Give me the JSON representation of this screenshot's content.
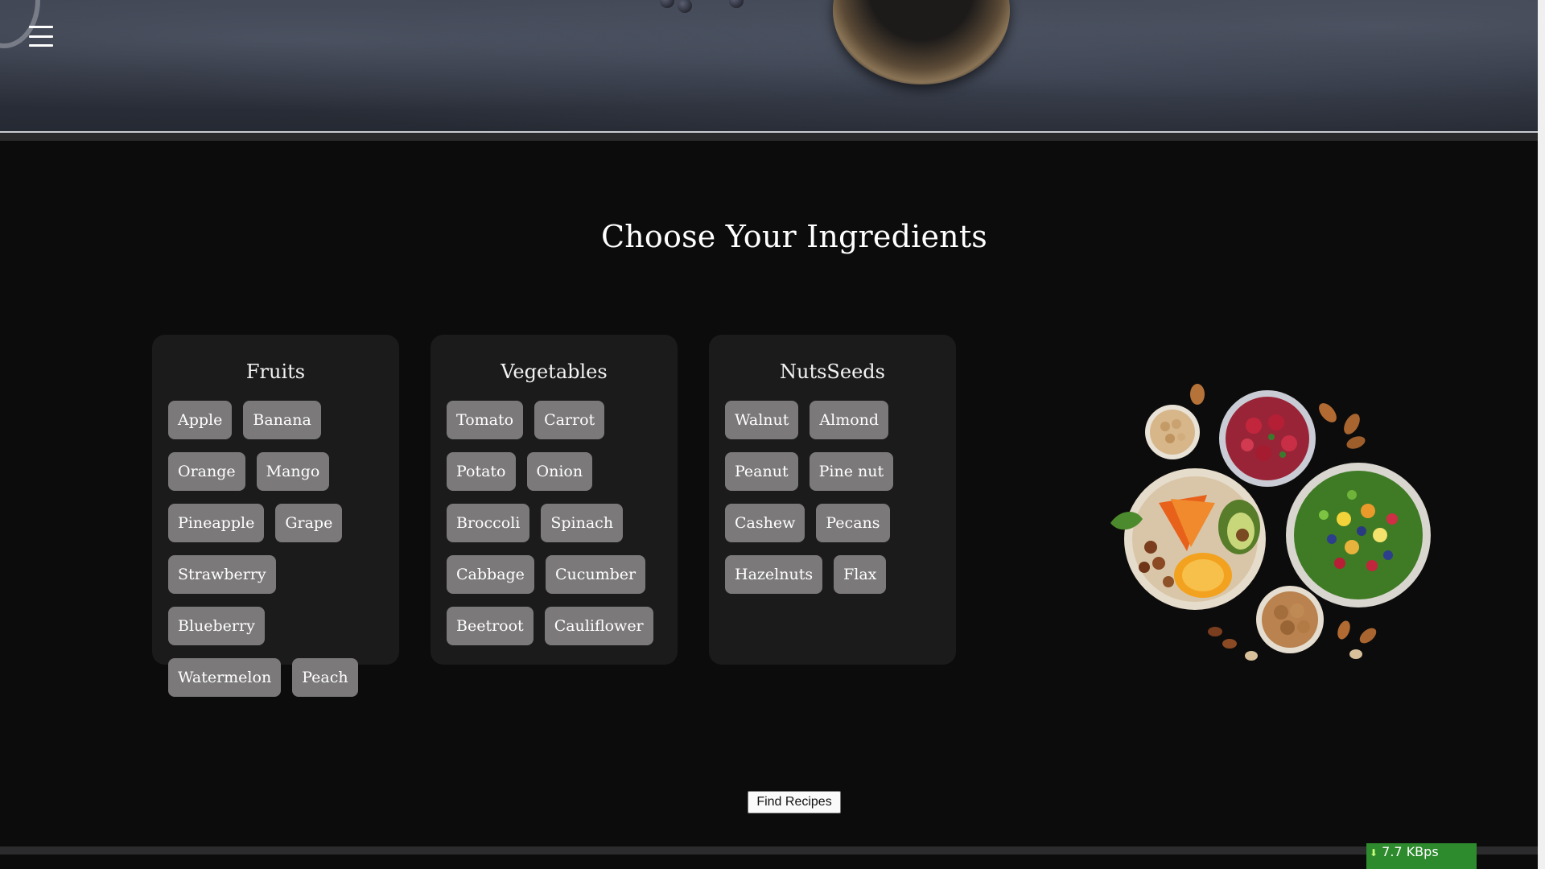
{
  "header": {
    "menu_icon": "hamburger-menu-icon"
  },
  "page": {
    "title": "Choose Your Ingredients"
  },
  "categories": [
    {
      "name": "Fruits",
      "items": [
        "Apple",
        "Banana",
        "Orange",
        "Mango",
        "Pineapple",
        "Grape",
        "Strawberry",
        "Blueberry",
        "Watermelon",
        "Peach"
      ]
    },
    {
      "name": "Vegetables",
      "items": [
        "Tomato",
        "Carrot",
        "Potato",
        "Onion",
        "Broccoli",
        "Spinach",
        "Cabbage",
        "Cucumber",
        "Beetroot",
        "Cauliflower"
      ]
    },
    {
      "name": "NutsSeeds",
      "items": [
        "Walnut",
        "Almond",
        "Peanut",
        "Pine nut",
        "Cashew",
        "Pecans",
        "Hazelnuts",
        "Flax"
      ]
    }
  ],
  "actions": {
    "find_label": "Find Recipes"
  },
  "network_badge": {
    "download": "7.7 KBps",
    "download_icon": "down-arrow-icon"
  },
  "colors": {
    "background": "#0d0c0c",
    "card": "#1b1b1c",
    "chip": "#7b7979",
    "badge": "#2d8a2d"
  }
}
